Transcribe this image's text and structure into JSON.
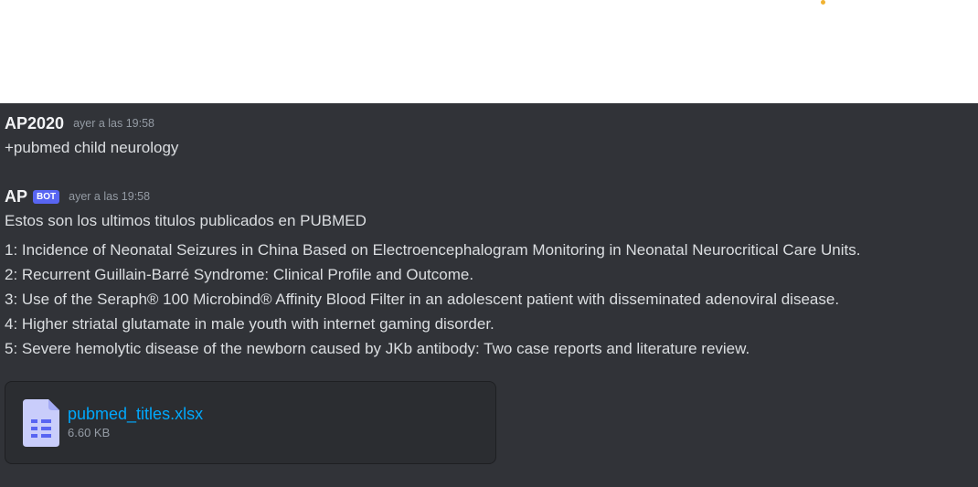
{
  "messages": [
    {
      "username": "AP2020",
      "timestamp": "ayer a las 19:58",
      "text": "+pubmed child neurology"
    },
    {
      "username": "AP",
      "badge": "BOT",
      "timestamp": "ayer a las 19:58",
      "intro": "Estos son los ultimos titulos publicados en PUBMED",
      "titles": [
        "1: Incidence of Neonatal Seizures in China Based on Electroencephalogram Monitoring in Neonatal Neurocritical Care Units.",
        "2: Recurrent Guillain-Barré Syndrome: Clinical Profile and Outcome.",
        "3: Use of the Seraph® 100 Microbind® Affinity Blood Filter in an adolescent patient with disseminated adenoviral disease.",
        "4: Higher striatal glutamate in male youth with internet gaming disorder.",
        "5: Severe hemolytic disease of the newborn caused by JKb antibody: Two case reports and literature review."
      ],
      "attachment": {
        "file_name": "pubmed_titles.xlsx",
        "file_size": "6.60 KB",
        "icon": "spreadsheet-file-icon"
      }
    }
  ],
  "colors": {
    "background": "#313338",
    "text": "#dbdee1",
    "username": "#f2f3f5",
    "timestamp": "#949ba4",
    "bot_badge": "#5865f2",
    "link": "#00a8fc",
    "attachment_bg": "#2b2d31",
    "file_icon": "#c9cdfb"
  }
}
